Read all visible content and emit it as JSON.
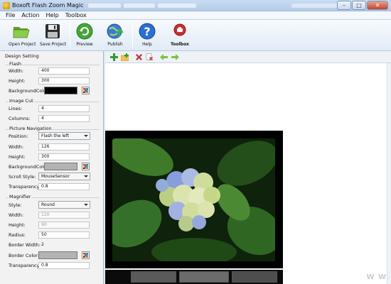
{
  "window": {
    "title": "Boxoft Flash Zoom Magic",
    "controls": [
      "–",
      "□",
      "✕"
    ]
  },
  "menu": [
    "File",
    "Action",
    "Help",
    "Toolbox"
  ],
  "toolbar": {
    "open_project": "Open Project",
    "save_project": "Save Project",
    "preview": "Preview",
    "publish": "Publish",
    "help": "Help",
    "toolbox": "Toolbox"
  },
  "design": {
    "title": "Design Setting",
    "flash": {
      "label": "Flash",
      "width_label": "Width:",
      "width": "400",
      "height_label": "Height:",
      "height": "300",
      "bg_label": "BackgroundColor:",
      "bg_color": "#000000"
    },
    "image_cut": {
      "label": "Image Cut",
      "lines_label": "Lines:",
      "lines": "4",
      "columns_label": "Columns:",
      "columns": "4"
    },
    "picture_nav": {
      "label": "Picture Navigation",
      "position_label": "Position:",
      "position": "Flash the left",
      "width_label": "Width:",
      "width": "126",
      "height_label": "Height:",
      "height": "300",
      "bg_label": "BackgroundColor:",
      "bg_color": "#b3b3b3",
      "scroll_label": "Scroll Style:",
      "scroll_style": "MouseSensor",
      "transparency_label": "Transparency:",
      "transparency": "0.8"
    },
    "magnifier": {
      "label": "Magnifier",
      "style_label": "Style:",
      "style": "Round",
      "width_label": "Width:",
      "width": "120",
      "height_label": "Height:",
      "height": "90",
      "radius_label": "Radius:",
      "radius": "50",
      "border_width_label": "Border Width:",
      "border_width": "2",
      "border_color_label": "Border Color:",
      "border_color": "#b3b3b3",
      "transparency_label": "Transparency:",
      "transparency": "0.8"
    }
  },
  "watermark": "W W"
}
